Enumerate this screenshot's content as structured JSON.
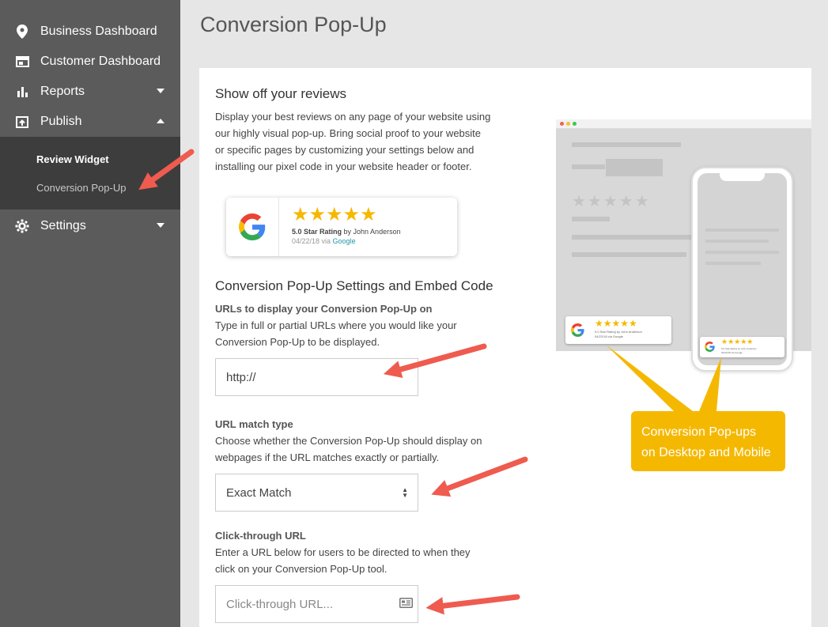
{
  "sidebar": {
    "items": [
      {
        "label": "Business Dashboard"
      },
      {
        "label": "Customer Dashboard"
      },
      {
        "label": "Reports"
      },
      {
        "label": "Publish"
      },
      {
        "label": "Settings"
      }
    ],
    "submenu": [
      {
        "label": "Review Widget"
      },
      {
        "label": "Conversion Pop-Up"
      }
    ]
  },
  "page": {
    "title": "Conversion Pop-Up"
  },
  "intro": {
    "heading": "Show off your reviews",
    "lines": [
      "Display your best reviews on any page of your website using",
      "our highly visual pop-up. Bring social proof to your website",
      "or specific pages by customizing your settings below and",
      "installing our pixel code in your website header or footer."
    ]
  },
  "badge": {
    "stars": "★★★★★",
    "rating_bold": "5.0 Star Rating",
    "rating_rest": " by John Anderson",
    "date": "04/22/18 via ",
    "source": "Google"
  },
  "settings": {
    "heading": "Conversion Pop-Up Settings and Embed Code",
    "urls": {
      "label": "URLs to display your Conversion Pop-Up on",
      "help": [
        "Type in full or partial URLs where you would like your",
        "Conversion Pop-Up to be displayed."
      ],
      "value": "http://"
    },
    "match": {
      "label": "URL match type",
      "help": [
        "Choose whether the Conversion Pop-Up should display on",
        "webpages if the URL matches exactly or partially."
      ],
      "value": "Exact Match"
    },
    "click": {
      "label": "Click-through URL",
      "help": [
        "Enter a URL below for users to be directed to when they",
        "click on your Conversion Pop-Up tool."
      ],
      "placeholder": "Click-through URL..."
    }
  },
  "preview": {
    "mini_rating_desktop": "5.0 Star Rating by John Anderson",
    "mini_date_desktop": "04/22/18 via Google",
    "mini_rating_mobile": "5.0 Star Rating by John Anderson",
    "mini_date_mobile": "04/22/18 via Google"
  },
  "callout": {
    "lines": [
      "Conversion Pop-ups",
      "on Desktop and Mobile"
    ]
  },
  "colors": {
    "sidebar": "#5b5b5b",
    "submenu": "#3d3d3d",
    "star": "#f5b800",
    "callout": "#f5b800",
    "arrow": "#ef5b4f"
  }
}
